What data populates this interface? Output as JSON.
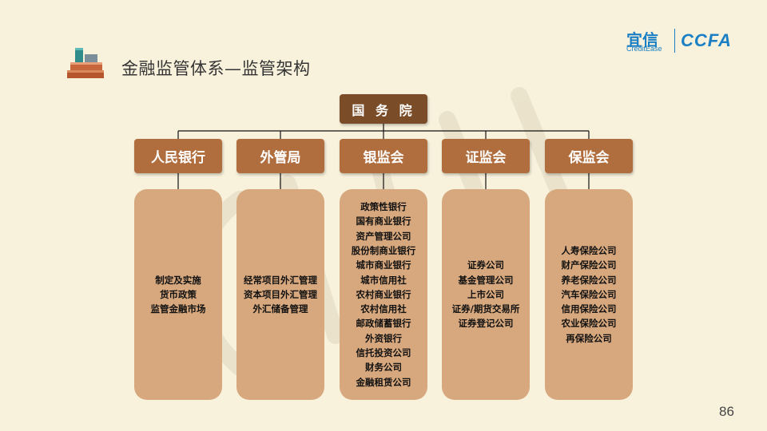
{
  "title": "金融监管体系—监管架构",
  "logo": {
    "cn": "宜信",
    "en": "CreditEase",
    "mark": "CCFA"
  },
  "top": {
    "label": "国 务 院"
  },
  "columns": [
    {
      "label": "人民银行",
      "items": [
        "制定及实施",
        "货币政策",
        "监管金融市场"
      ]
    },
    {
      "label": "外管局",
      "items": [
        "经常项目外汇管理",
        "资本项目外汇管理",
        "外汇储备管理"
      ]
    },
    {
      "label": "银监会",
      "items": [
        "政策性银行",
        "国有商业银行",
        "资产管理公司",
        "股份制商业银行",
        "城市商业银行",
        "城市信用社",
        "农村商业银行",
        "农村信用社",
        "邮政储蓄银行",
        "外资银行",
        "信托投资公司",
        "财务公司",
        "金融租赁公司"
      ]
    },
    {
      "label": "证监会",
      "items": [
        "证券公司",
        "基金管理公司",
        "上市公司",
        "证券/期货交易所",
        "证券登记公司"
      ]
    },
    {
      "label": "保监会",
      "items": [
        "人寿保险公司",
        "财产保险公司",
        "养老保险公司",
        "汽车保险公司",
        "信用保险公司",
        "农业保险公司",
        "再保险公司"
      ]
    }
  ],
  "page_number": "86",
  "colors": {
    "background": "#f8f2dc",
    "top_box": "#7b4c28",
    "head_box": "#b06e3e",
    "detail_box": "#d7a87d",
    "brand": "#1a7fc4"
  },
  "icons": {
    "title": "books-icon"
  }
}
